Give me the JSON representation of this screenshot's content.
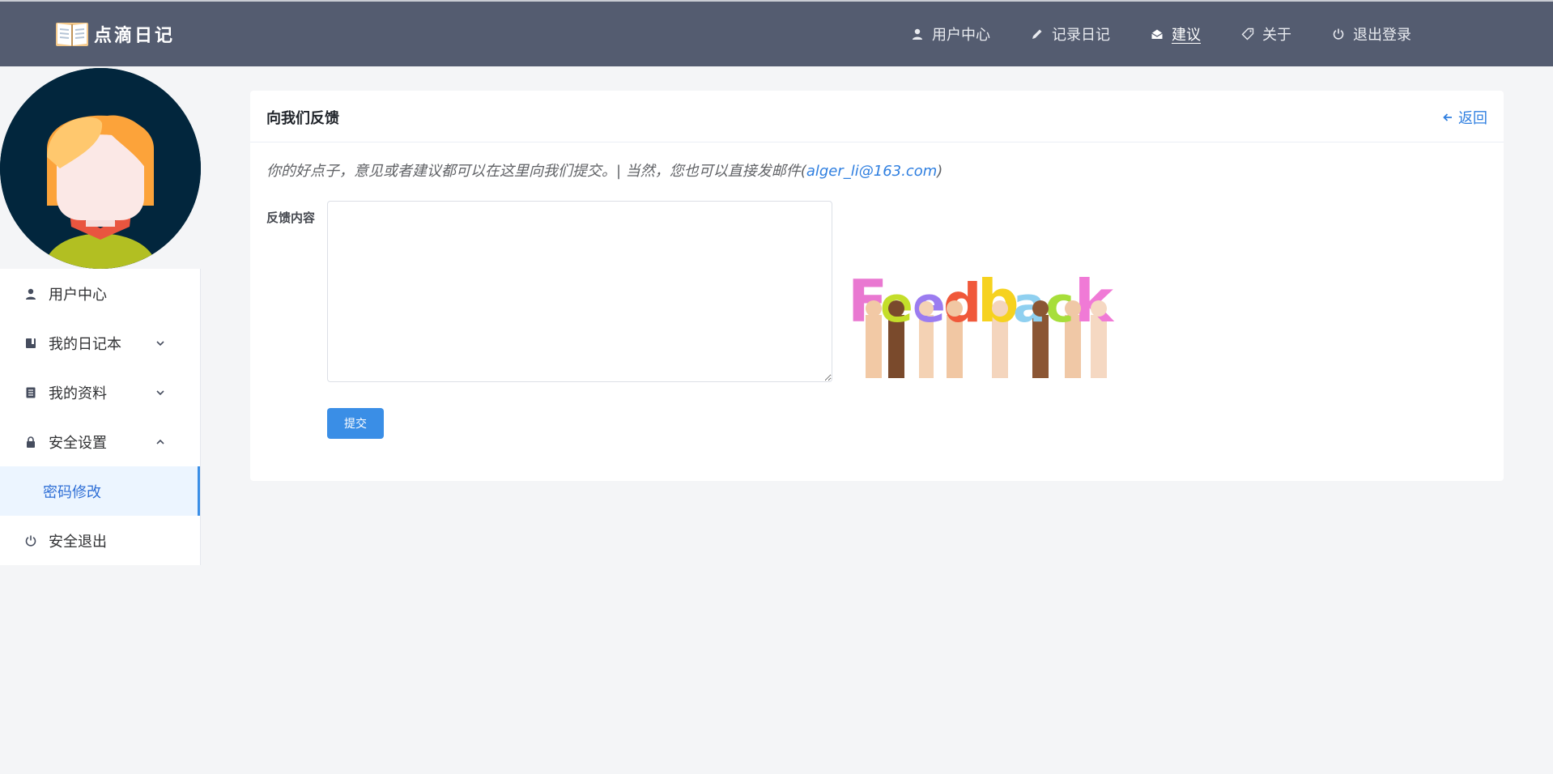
{
  "header": {
    "logo_text": "点滴日记",
    "nav": [
      {
        "label": "用户中心",
        "icon": "person-icon"
      },
      {
        "label": "记录日记",
        "icon": "pencil-icon"
      },
      {
        "label": "建议",
        "icon": "envelope-open-icon"
      },
      {
        "label": "关于",
        "icon": "tag-icon"
      },
      {
        "label": "退出登录",
        "icon": "power-icon"
      }
    ],
    "active_nav": "建议"
  },
  "sidebar": {
    "items": [
      {
        "label": "用户中心",
        "icon": "person-icon"
      },
      {
        "label": "我的日记本",
        "icon": "notebook-icon",
        "expandable": true,
        "expanded": false
      },
      {
        "label": "我的资料",
        "icon": "document-icon",
        "expandable": true,
        "expanded": false
      },
      {
        "label": "安全设置",
        "icon": "lock-icon",
        "expandable": true,
        "expanded": true
      },
      {
        "label": "安全退出",
        "icon": "power-icon"
      }
    ],
    "submenu": {
      "label": "密码修改",
      "active": true
    }
  },
  "card": {
    "title": "向我们反馈",
    "back_label": "返回",
    "intro_text": "你的好点子，意见或者建议都可以在这里向我们提交。| 当然，您也可以直接发邮件(",
    "email": "alger_li@163.com",
    "intro_close": ")",
    "field_label": "反馈内容",
    "textarea_value": "",
    "textarea_placeholder": "",
    "submit_label": "提交",
    "feedback_image_text": "Feedback"
  },
  "colors": {
    "header_bg": "#545c70",
    "accent": "#3a8ee6",
    "submenu_bg": "#ecf5ff",
    "avatar_bg": "#02263d",
    "page_bg": "#f4f5f7"
  }
}
